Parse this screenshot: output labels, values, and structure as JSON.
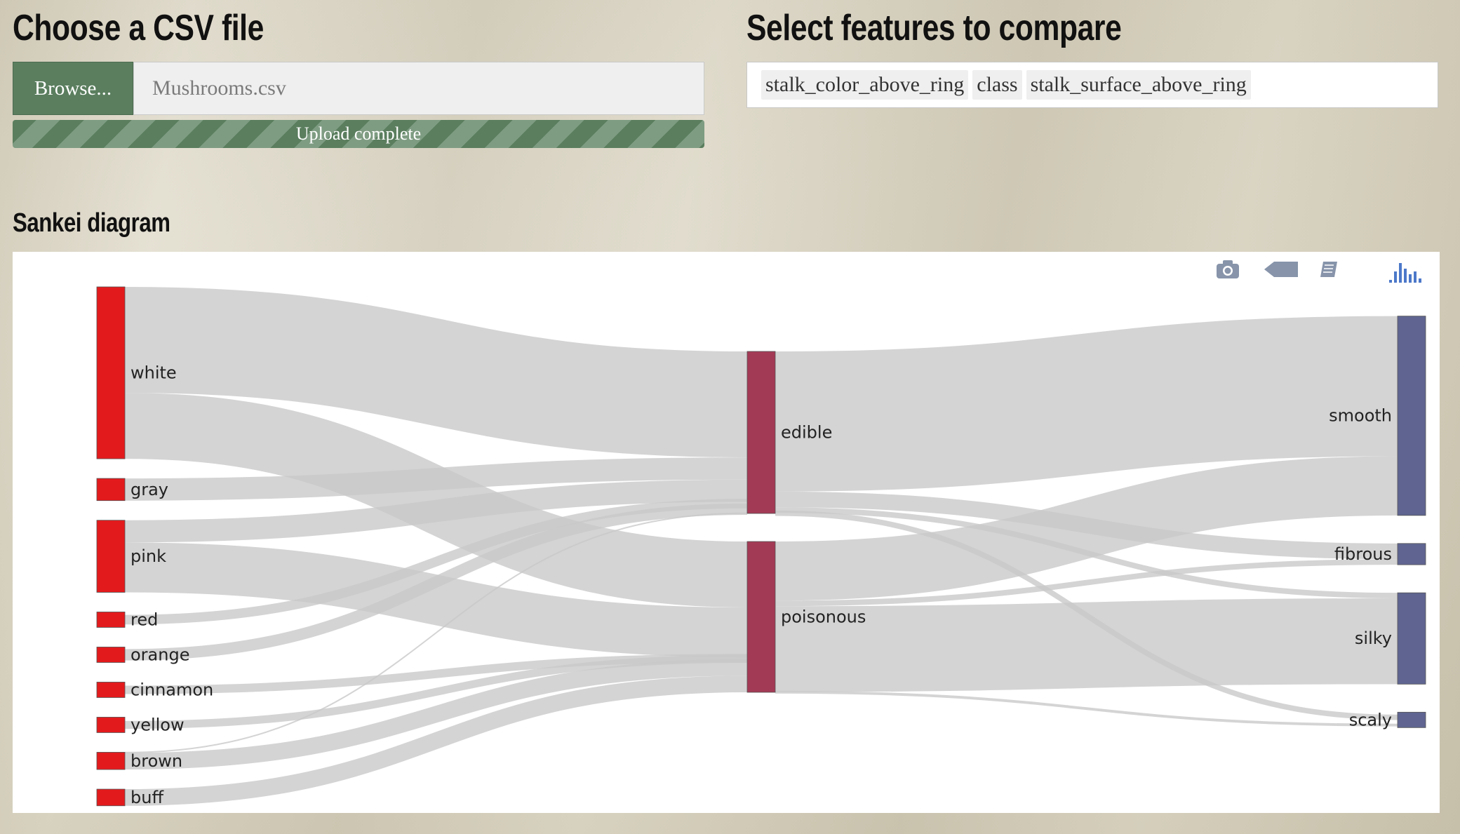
{
  "upload": {
    "heading": "Choose a CSV file",
    "browse_label": "Browse...",
    "file_name": "Mushrooms.csv",
    "progress_label": "Upload complete",
    "progress": 1.0
  },
  "features": {
    "heading": "Select features to compare",
    "selected": [
      "stalk_color_above_ring",
      "class",
      "stalk_surface_above_ring"
    ]
  },
  "sankey": {
    "heading": "Sankei diagram"
  },
  "modebar": {
    "icons": [
      "camera-icon",
      "tag-icon",
      "book-icon",
      "plotly-logo-icon"
    ]
  },
  "colors": {
    "button_green": "#5a7e5e",
    "source_node": "#e31a1c",
    "class_node": "#a33a55",
    "surface_node": "#5f6590",
    "link": "#c8c8c8"
  },
  "chart_data": {
    "type": "sankey",
    "columns": [
      [
        "white",
        "gray",
        "pink",
        "red",
        "orange",
        "cinnamon",
        "yellow",
        "brown",
        "buff"
      ],
      [
        "edible",
        "poisonous"
      ],
      [
        "smooth",
        "fibrous",
        "silky",
        "scaly"
      ]
    ],
    "nodes": [
      {
        "label": "white",
        "column": 0,
        "value": 4464
      },
      {
        "label": "gray",
        "column": 0,
        "value": 576
      },
      {
        "label": "pink",
        "column": 0,
        "value": 1872
      },
      {
        "label": "red",
        "column": 0,
        "value": 96
      },
      {
        "label": "orange",
        "column": 0,
        "value": 192
      },
      {
        "label": "cinnamon",
        "column": 0,
        "value": 36
      },
      {
        "label": "yellow",
        "column": 0,
        "value": 8
      },
      {
        "label": "brown",
        "column": 0,
        "value": 448
      },
      {
        "label": "buff",
        "column": 0,
        "value": 432
      },
      {
        "label": "edible",
        "column": 1,
        "value": 4208
      },
      {
        "label": "poisonous",
        "column": 1,
        "value": 3916
      },
      {
        "label": "smooth",
        "column": 2,
        "value": 5176
      },
      {
        "label": "fibrous",
        "column": 2,
        "value": 552
      },
      {
        "label": "silky",
        "column": 2,
        "value": 2372
      },
      {
        "label": "scaly",
        "column": 2,
        "value": 24
      }
    ],
    "links": [
      {
        "source": "white",
        "target": "edible",
        "value": 2752
      },
      {
        "source": "white",
        "target": "poisonous",
        "value": 1712
      },
      {
        "source": "gray",
        "target": "edible",
        "value": 576
      },
      {
        "source": "pink",
        "target": "edible",
        "value": 576
      },
      {
        "source": "pink",
        "target": "poisonous",
        "value": 1296
      },
      {
        "source": "red",
        "target": "edible",
        "value": 96
      },
      {
        "source": "orange",
        "target": "edible",
        "value": 192
      },
      {
        "source": "cinnamon",
        "target": "poisonous",
        "value": 36
      },
      {
        "source": "yellow",
        "target": "poisonous",
        "value": 8
      },
      {
        "source": "brown",
        "target": "edible",
        "value": 16
      },
      {
        "source": "brown",
        "target": "poisonous",
        "value": 432
      },
      {
        "source": "buff",
        "target": "poisonous",
        "value": 432
      },
      {
        "source": "edible",
        "target": "smooth",
        "value": 3640
      },
      {
        "source": "edible",
        "target": "fibrous",
        "value": 408
      },
      {
        "source": "edible",
        "target": "silky",
        "value": 144
      },
      {
        "source": "edible",
        "target": "scaly",
        "value": 16
      },
      {
        "source": "poisonous",
        "target": "smooth",
        "value": 1536
      },
      {
        "source": "poisonous",
        "target": "fibrous",
        "value": 144
      },
      {
        "source": "poisonous",
        "target": "silky",
        "value": 2228
      },
      {
        "source": "poisonous",
        "target": "scaly",
        "value": 8
      }
    ]
  }
}
